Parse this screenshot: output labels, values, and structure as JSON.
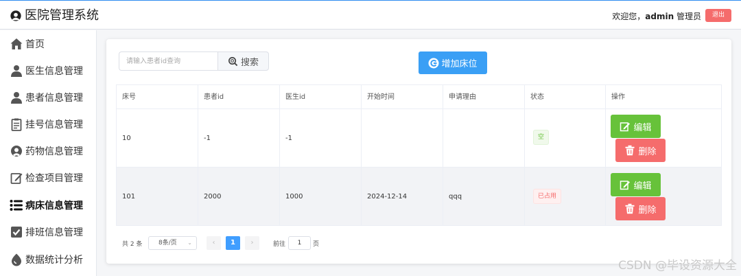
{
  "app": {
    "title": "医院管理系统"
  },
  "header": {
    "welcome_prefix": "欢迎您，",
    "username": "admin",
    "role": "管理员",
    "logout_label": "退出"
  },
  "sidebar": {
    "items": [
      {
        "label": "首页",
        "icon": "home-icon"
      },
      {
        "label": "医生信息管理",
        "icon": "user-icon"
      },
      {
        "label": "患者信息管理",
        "icon": "user-icon"
      },
      {
        "label": "挂号信息管理",
        "icon": "clipboard-icon"
      },
      {
        "label": "药物信息管理",
        "icon": "pill-icon"
      },
      {
        "label": "检查项目管理",
        "icon": "edit-icon"
      },
      {
        "label": "病床信息管理",
        "icon": "list-icon",
        "active": true
      },
      {
        "label": "排班信息管理",
        "icon": "checkbox-icon"
      },
      {
        "label": "数据统计分析",
        "icon": "chart-icon"
      }
    ]
  },
  "toolbar": {
    "search_placeholder": "请输入患者id查询",
    "search_label": "搜索",
    "add_label": "增加床位"
  },
  "table": {
    "columns": [
      "床号",
      "患者id",
      "医生id",
      "开始时间",
      "申请理由",
      "状态",
      "操作"
    ],
    "rows": [
      {
        "bed_no": "10",
        "patient_id": "-1",
        "doctor_id": "-1",
        "start_time": "",
        "reason": "",
        "status": "空",
        "status_type": "free"
      },
      {
        "bed_no": "101",
        "patient_id": "2000",
        "doctor_id": "1000",
        "start_time": "2024-12-14",
        "reason": "qqq",
        "status": "已占用",
        "status_type": "used"
      }
    ],
    "edit_label": "编辑",
    "delete_label": "删除"
  },
  "pagination": {
    "total_text": "共 2 条",
    "page_size": "8条/页",
    "current_page": "1",
    "goto_label": "前往",
    "goto_value": "1",
    "page_unit": "页"
  },
  "watermark": "CSDN @毕设资源大全",
  "colors": {
    "primary": "#3a9ff5",
    "success": "#67c23a",
    "danger": "#f56c6c"
  }
}
